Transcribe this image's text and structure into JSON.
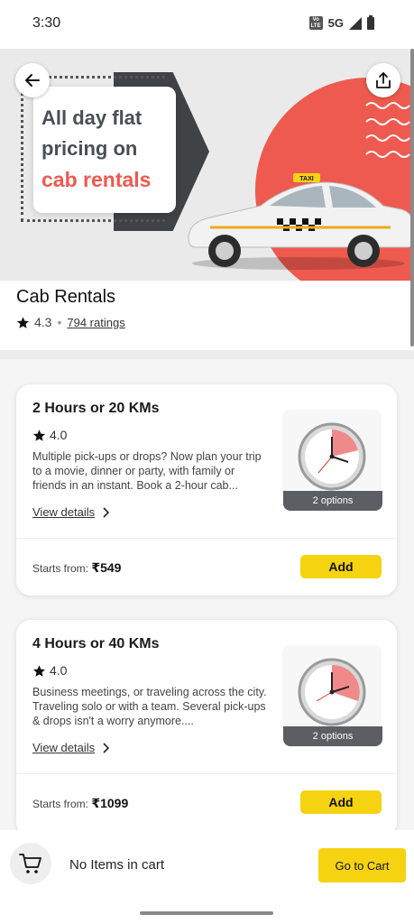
{
  "status_bar": {
    "time": "3:30",
    "volte": "Vo LTE",
    "network": "5G"
  },
  "hero": {
    "line1": "All day flat",
    "line2": "pricing on",
    "line3": "cab rentals",
    "taxi_sign": "TAXI",
    "colors": {
      "accent_red": "#ee5a4f",
      "dark": "#3f4346"
    }
  },
  "header": {
    "title": "Cab Rentals",
    "rating": "4.3",
    "separator": "•",
    "ratings_count": "794 ratings"
  },
  "services": [
    {
      "title": "2 Hours or 20 KMs",
      "rating": "4.0",
      "description": "Multiple pick-ups or drops? Now plan your trip to a movie, dinner or party, with family or friends in an instant. Book a 2-hour cab...",
      "link": "View details",
      "options": "2 options",
      "price_label": "Starts from:",
      "price": "₹549",
      "add_label": "Add"
    },
    {
      "title": "4 Hours or 40 KMs",
      "rating": "4.0",
      "description": "Business meetings, or traveling across the city. Traveling solo or with a team. Several pick-ups & drops isn't a worry anymore....",
      "link": "View details",
      "options": "2 options",
      "price_label": "Starts from:",
      "price": "₹1099",
      "add_label": "Add"
    }
  ],
  "cart": {
    "text": "No Items in cart",
    "button": "Go to Cart"
  },
  "icons": [
    "back-arrow-icon",
    "share-icon",
    "star-icon",
    "chevron-right-icon",
    "cart-icon",
    "clock-icon",
    "signal-icon",
    "battery-icon"
  ],
  "colors": {
    "brand_yellow": "#f5d311"
  }
}
